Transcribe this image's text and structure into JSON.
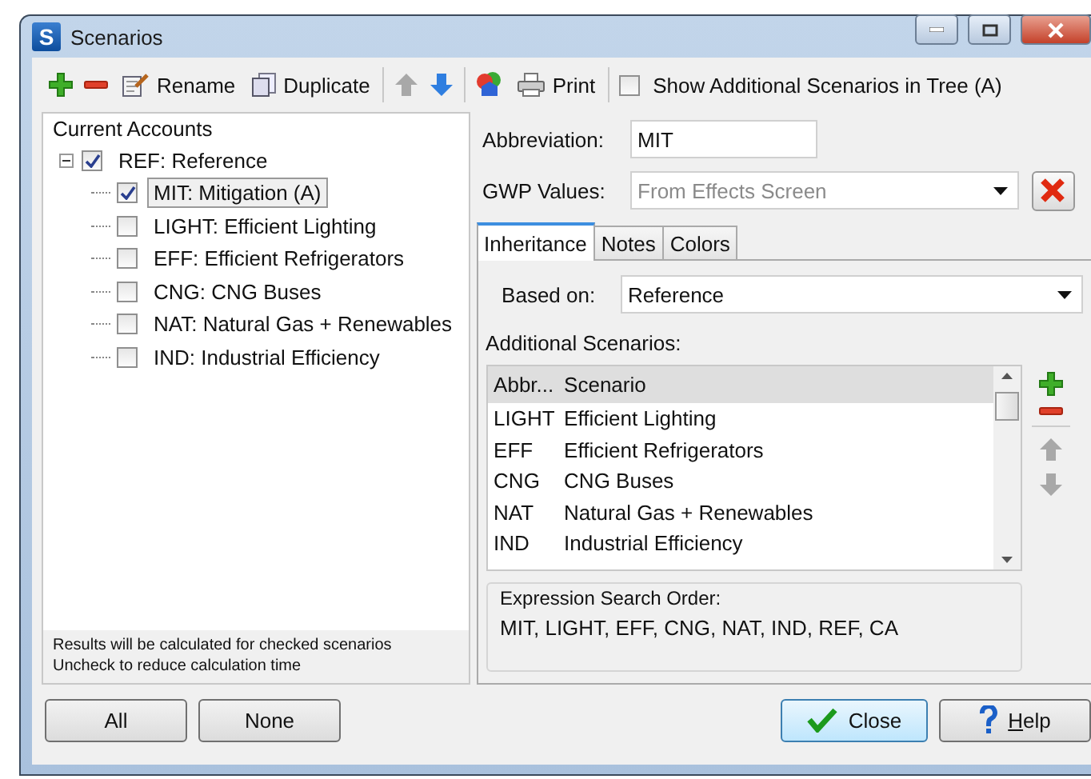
{
  "window": {
    "title": "Scenarios",
    "app_letter": "S"
  },
  "toolbar": {
    "rename": "Rename",
    "duplicate": "Duplicate",
    "print": "Print",
    "show_additional": {
      "label": "Show Additional Scenarios in Tree (A)",
      "checked": false
    }
  },
  "tree": {
    "heading": "Current Accounts",
    "items": [
      {
        "label": "REF: Reference",
        "checked": true,
        "selected": false,
        "expanded": true,
        "children": [
          {
            "label": "MIT: Mitigation (A)",
            "checked": true,
            "selected": true
          },
          {
            "label": "LIGHT: Efficient Lighting",
            "checked": false,
            "selected": false
          },
          {
            "label": "EFF: Efficient Refrigerators",
            "checked": false,
            "selected": false
          },
          {
            "label": "CNG: CNG Buses",
            "checked": false,
            "selected": false
          },
          {
            "label": "NAT: Natural Gas + Renewables",
            "checked": false,
            "selected": false
          },
          {
            "label": "IND: Industrial Efficiency",
            "checked": false,
            "selected": false
          }
        ]
      }
    ],
    "note": [
      "Results will be calculated for checked scenarios",
      "Uncheck to reduce calculation time"
    ]
  },
  "abbreviation": {
    "label": "Abbreviation:",
    "value": "MIT"
  },
  "gwp": {
    "label": "GWP Values:",
    "value": "From Effects Screen",
    "disabled": true
  },
  "tabs": [
    {
      "label": "Inheritance",
      "selected": true
    },
    {
      "label": "Notes",
      "selected": false
    },
    {
      "label": "Colors",
      "selected": false
    }
  ],
  "based_on": {
    "label": "Based on:",
    "value": "Reference"
  },
  "additional": {
    "label": "Additional Scenarios:",
    "columns": [
      "Abbr...",
      "Scenario"
    ],
    "rows": [
      [
        "LIGHT",
        "Efficient Lighting"
      ],
      [
        "EFF",
        "Efficient Refrigerators"
      ],
      [
        "CNG",
        "CNG Buses"
      ],
      [
        "NAT",
        "Natural Gas + Renewables"
      ],
      [
        "IND",
        "Industrial Efficiency"
      ]
    ]
  },
  "search_order": {
    "label": "Expression Search Order:",
    "value": "MIT, LIGHT, EFF, CNG, NAT, IND, REF, CA"
  },
  "buttons": {
    "all": "All",
    "none": "None",
    "close": "Close",
    "help": "Help"
  }
}
